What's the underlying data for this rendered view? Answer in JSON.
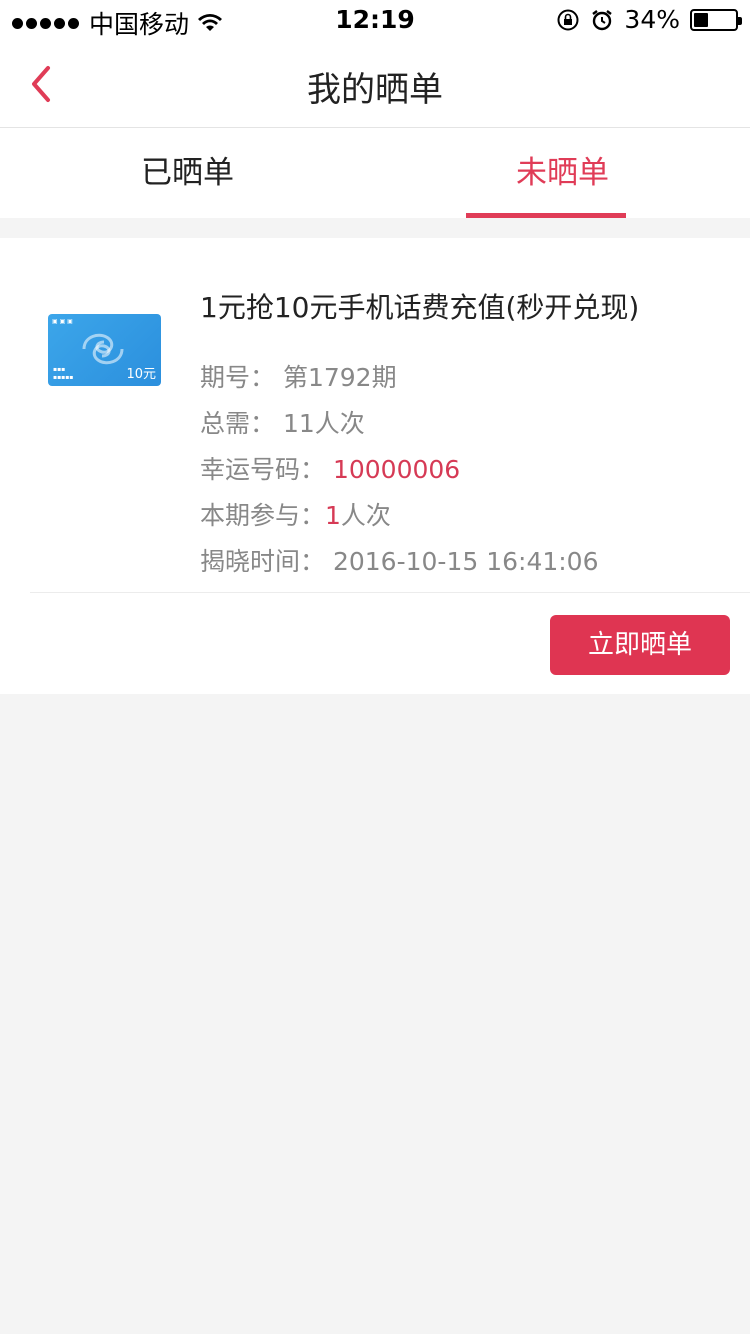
{
  "status_bar": {
    "carrier": "中国移动",
    "time": "12:19",
    "battery": "34%",
    "battery_level": 0.34
  },
  "nav": {
    "title": "我的晒单",
    "back_icon": "chevron-left-icon"
  },
  "tabs": [
    {
      "label": "已晒单",
      "active": false
    },
    {
      "label": "未晒单",
      "active": true
    }
  ],
  "colors": {
    "accent": "#e03c57",
    "background": "#f4f4f4"
  },
  "item": {
    "title": "1元抢10元手机话费充值(秒开兑现)",
    "thumb_value": "10元",
    "period_label": "期号：",
    "period_value": "第1792期",
    "total_label": "总需：",
    "total_value": "11人次",
    "lucky_label": "幸运号码：",
    "lucky_value": "10000006",
    "join_label": "本期参与：",
    "join_count": "1",
    "join_unit": "人次",
    "reveal_label": "揭晓时间：",
    "reveal_value": "2016-10-15 16:41:06",
    "share_button": "立即晒单"
  }
}
